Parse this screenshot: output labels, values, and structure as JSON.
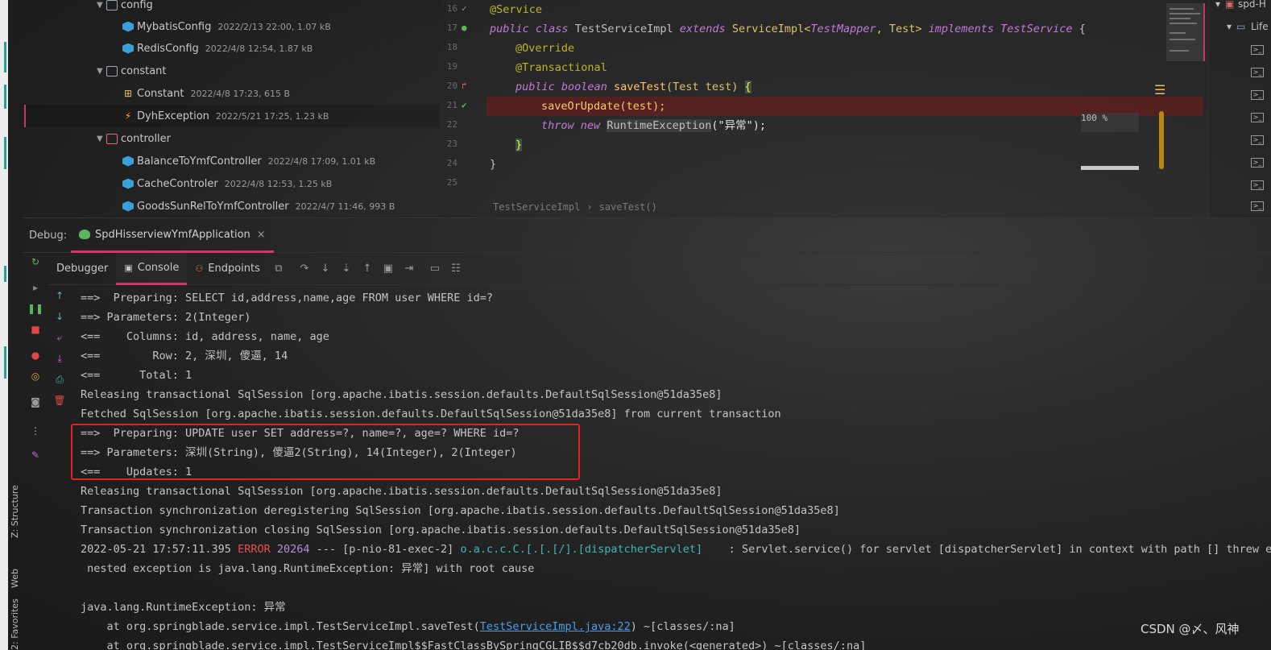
{
  "project_tree": [
    {
      "name": "config",
      "meta": "",
      "kind": "folder",
      "expanded": true
    },
    {
      "name": "MybatisConfig",
      "meta": "2022/2/13 22:00, 1.07 kB",
      "kind": "class"
    },
    {
      "name": "RedisConfig",
      "meta": "2022/4/8 12:54, 1.87 kB",
      "kind": "class"
    },
    {
      "name": "constant",
      "meta": "",
      "kind": "folder",
      "expanded": true
    },
    {
      "name": "Constant",
      "meta": "2022/4/8 17:23, 615 B",
      "kind": "const"
    },
    {
      "name": "DyhException",
      "meta": "2022/5/21 17:25, 1.23 kB",
      "kind": "exception",
      "selected": true
    },
    {
      "name": "controller",
      "meta": "",
      "kind": "folder",
      "expanded": true
    },
    {
      "name": "BalanceToYmfController",
      "meta": "2022/4/8 17:09, 1.01 kB",
      "kind": "class"
    },
    {
      "name": "CacheControler",
      "meta": "2022/4/8 12:53, 1.25 kB",
      "kind": "class"
    },
    {
      "name": "GoodsSunRelToYmfController",
      "meta": "2022/4/7 11:46, 993 B",
      "kind": "class"
    }
  ],
  "editor": {
    "line_numbers": [
      "16",
      "17",
      "18",
      "19",
      "20",
      "21",
      "22",
      "23",
      "24",
      "25"
    ],
    "code": {
      "l16_anno": "@Service",
      "l17_public": "public",
      "l17_class": "class",
      "l17_name": "TestServiceImpl",
      "l17_extends": "extends",
      "l17_super": "ServiceImpl<",
      "l17_mapper": "TestMapper",
      "l17_comma": ", Test> ",
      "l17_implements": "implements",
      "l17_iface": "TestService",
      "l17_brace": " {",
      "l18_anno": "@Override",
      "l19_anno": "@Transactional",
      "l20_public": "public",
      "l20_boolean": "boolean",
      "l20_method": "saveTest",
      "l20_params": "(Test test) ",
      "l20_brace": "{",
      "l21_code": "saveOrUpdate(test);",
      "l22_throw": "throw",
      "l22_new": "new",
      "l22_ex": "RuntimeException",
      "l22_arg": "(\"异常\");",
      "l23_brace": "}",
      "l24_brace": "}"
    },
    "breadcrumbs": [
      "TestServiceImpl",
      "saveTest()"
    ],
    "zoom_label": "100 %"
  },
  "right_panel": {
    "label_top": "spd-H",
    "label_lifecycle": "Life"
  },
  "debug": {
    "label": "Debug:",
    "config_tab": "SpdHisserviewYmfApplication",
    "close_symbol": "×",
    "tabs": [
      {
        "label": "Debugger",
        "icon": ""
      },
      {
        "label": "Console",
        "icon": "▣"
      },
      {
        "label": "Endpoints",
        "icon": "⚇"
      }
    ]
  },
  "side_tabs": {
    "structure": "Z: Structure",
    "web": "Web",
    "favorites": "2: Favorites"
  },
  "console_lines": [
    "==>  Preparing: SELECT id,address,name,age FROM user WHERE id=?",
    "==> Parameters: 2(Integer)",
    "<==    Columns: id, address, name, age",
    "<==        Row: 2, 深圳, 傻逼, 14",
    "<==      Total: 1",
    "Releasing transactional SqlSession [org.apache.ibatis.session.defaults.DefaultSqlSession@51da35e8]",
    "Fetched SqlSession [org.apache.ibatis.session.defaults.DefaultSqlSession@51da35e8] from current transaction",
    "==>  Preparing: UPDATE user SET address=?, name=?, age=? WHERE id=?",
    "==> Parameters: 深圳(String), 傻逼2(String), 14(Integer), 2(Integer)",
    "<==    Updates: 1",
    "Releasing transactional SqlSession [org.apache.ibatis.session.defaults.DefaultSqlSession@51da35e8]",
    "Transaction synchronization deregistering SqlSession [org.apache.ibatis.session.defaults.DefaultSqlSession@51da35e8]",
    "Transaction synchronization closing SqlSession [org.apache.ibatis.session.defaults.DefaultSqlSession@51da35e8]"
  ],
  "error_line": {
    "timestamp": "2022-05-21 17:57:11.395 ",
    "level": "ERROR",
    "pid": " 20264",
    "thread": " --- [p-nio-81-exec-2] ",
    "logger": "o.a.c.c.C.[.[.[/].[dispatcherServlet]",
    "message": "    : Servlet.service() for servlet [dispatcherServlet] in context with path [] threw exce"
  },
  "nested_line": " nested exception is java.lang.RuntimeException: 异常] with root cause",
  "exception_line": "java.lang.RuntimeException: 异常",
  "stack_1_prefix": "    at org.springblade.service.impl.TestServiceImpl.saveTest(",
  "stack_1_link": "TestServiceImpl.java:22",
  "stack_1_suffix": ") ~[classes/:na]",
  "stack_2": "    at org.springblade.service.impl.TestServiceImpl$$FastClassBySpringCGLIB$$d7cb20db.invoke(<generated>) ~[classes/:na]",
  "watermark": "CSDN @〆、风神",
  "colors": {
    "accent": "#d2356b",
    "highlight_box": "#e52222",
    "error": "#e15050",
    "link": "#4a9ee8"
  }
}
